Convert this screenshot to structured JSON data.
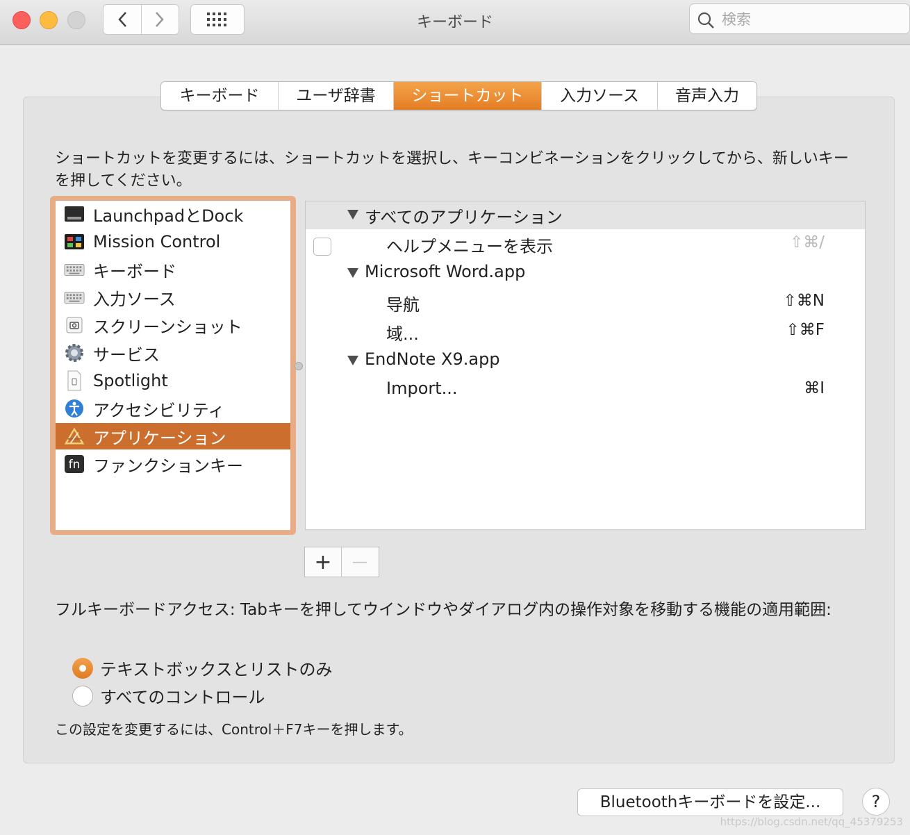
{
  "window": {
    "title": "キーボード",
    "search_placeholder": "検索"
  },
  "tabs": [
    {
      "label": "キーボード",
      "active": false
    },
    {
      "label": "ユーザ辞書",
      "active": false
    },
    {
      "label": "ショートカット",
      "active": true
    },
    {
      "label": "入力ソース",
      "active": false
    },
    {
      "label": "音声入力",
      "active": false
    }
  ],
  "instruction": "ショートカットを変更するには、ショートカットを選択し、キーコンビネーションをクリックしてから、新しいキーを押してください。",
  "categories": [
    {
      "label": "LaunchpadとDock",
      "icon": "launchpad-dock-icon"
    },
    {
      "label": "Mission Control",
      "icon": "mission-control-icon"
    },
    {
      "label": "キーボード",
      "icon": "keyboard-icon"
    },
    {
      "label": "入力ソース",
      "icon": "input-source-icon"
    },
    {
      "label": "スクリーンショット",
      "icon": "screenshot-icon"
    },
    {
      "label": "サービス",
      "icon": "gear-icon"
    },
    {
      "label": "Spotlight",
      "icon": "spotlight-icon"
    },
    {
      "label": "アクセシビリティ",
      "icon": "accessibility-icon"
    },
    {
      "label": "アプリケーション",
      "icon": "applications-icon",
      "selected": true
    },
    {
      "label": "ファンクションキー",
      "icon": "fn-key-icon"
    }
  ],
  "shortcuts": {
    "all_apps": {
      "label": "すべてのアプリケーション"
    },
    "show_help": {
      "label": "ヘルプメニューを表示",
      "keys": "⇧⌘/"
    },
    "word": {
      "label": "Microsoft Word.app"
    },
    "navigate": {
      "label": "导航",
      "keys": "⇧⌘N"
    },
    "field": {
      "label": "域...",
      "keys": "⇧⌘F"
    },
    "endnote": {
      "label": "EndNote X9.app"
    },
    "import": {
      "label": "Import...",
      "keys": "⌘I"
    }
  },
  "buttons": {
    "add": "+",
    "remove": "—",
    "bluetooth": "Bluetoothキーボードを設定...",
    "help": "?"
  },
  "full_keyboard_access": {
    "label": "フルキーボードアクセス: Tabキーを押してウインドウやダイアログ内の操作対象を移動する機能の適用範囲:",
    "options": [
      {
        "label": "テキストボックスとリストのみ",
        "selected": true
      },
      {
        "label": "すべてのコントロール",
        "selected": false
      }
    ],
    "note": "この設定を変更するには、Control＋F7キーを押します。"
  },
  "watermark": "https://blog.csdn.net/qq_45379253",
  "colors": {
    "accent": "#e47d24",
    "selection": "#cc6e2e"
  }
}
